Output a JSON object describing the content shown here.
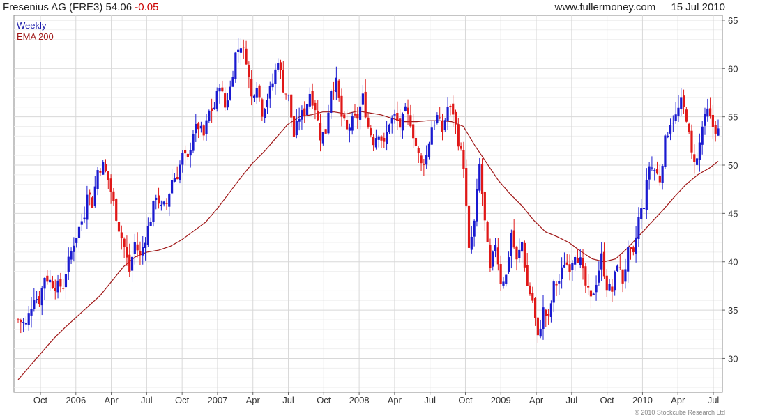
{
  "header": {
    "name_symbol": "Fresenius AG (FRE3)",
    "price": "54.06",
    "change": "-0.05",
    "site": "www.fullermoney.com",
    "date": "15 Jul 2010"
  },
  "legend": {
    "weekly": "Weekly",
    "ema": "EMA 200"
  },
  "copyright": "© 2010 Stockcube Research Ltd",
  "colors": {
    "up": "#1a1ad0",
    "down": "#e01818",
    "ema": "#a01818",
    "grid": "#d8d8d8",
    "minor_grid": "#efefef"
  },
  "chart_data": {
    "type": "candlestick",
    "interval": "weekly",
    "x_tick_labels": [
      "Oct",
      "2006",
      "Apr",
      "Jul",
      "Oct",
      "2007",
      "Apr",
      "Jul",
      "Oct",
      "2008",
      "Apr",
      "Jul",
      "Oct",
      "2009",
      "Apr",
      "Jul",
      "Oct",
      "2010",
      "Apr",
      "Jul"
    ],
    "y_ticks": [
      30,
      35,
      40,
      45,
      50,
      55,
      60,
      65
    ],
    "ylim": [
      26.5,
      65.5
    ],
    "grid": true,
    "legend_position": "top-left",
    "y_axis_side": "right",
    "series": [
      {
        "name": "EMA 200",
        "type": "line",
        "points": [
          [
            0,
            27.8
          ],
          [
            4,
            29.2
          ],
          [
            8,
            30.6
          ],
          [
            12,
            32.0
          ],
          [
            16,
            33.2
          ],
          [
            20,
            34.3
          ],
          [
            24,
            35.4
          ],
          [
            28,
            36.5
          ],
          [
            32,
            38.0
          ],
          [
            36,
            39.5
          ],
          [
            40,
            40.5
          ],
          [
            44,
            41.0
          ],
          [
            48,
            41.2
          ],
          [
            52,
            41.6
          ],
          [
            56,
            42.3
          ],
          [
            60,
            43.2
          ],
          [
            64,
            44.1
          ],
          [
            68,
            45.5
          ],
          [
            72,
            47.1
          ],
          [
            76,
            48.7
          ],
          [
            80,
            50.2
          ],
          [
            84,
            51.4
          ],
          [
            88,
            52.8
          ],
          [
            92,
            54.2
          ],
          [
            96,
            55.0
          ],
          [
            100,
            55.2
          ],
          [
            104,
            55.5
          ],
          [
            108,
            55.5
          ],
          [
            112,
            55.3
          ],
          [
            116,
            55.6
          ],
          [
            120,
            55.4
          ],
          [
            124,
            55.2
          ],
          [
            128,
            54.8
          ],
          [
            132,
            54.5
          ],
          [
            136,
            54.5
          ],
          [
            140,
            54.6
          ],
          [
            144,
            54.6
          ],
          [
            148,
            54.5
          ],
          [
            152,
            54.0
          ],
          [
            156,
            52.0
          ],
          [
            160,
            50.2
          ],
          [
            164,
            48.4
          ],
          [
            168,
            47.0
          ],
          [
            172,
            45.8
          ],
          [
            176,
            44.3
          ],
          [
            180,
            43.1
          ],
          [
            184,
            42.6
          ],
          [
            188,
            42.0
          ],
          [
            192,
            41.1
          ],
          [
            196,
            40.3
          ],
          [
            200,
            40.0
          ],
          [
            204,
            40.3
          ],
          [
            208,
            41.4
          ],
          [
            212,
            42.7
          ],
          [
            216,
            44.0
          ],
          [
            220,
            45.3
          ],
          [
            224,
            46.7
          ],
          [
            228,
            48.0
          ],
          [
            232,
            49.0
          ],
          [
            236,
            49.7
          ],
          [
            239,
            50.4
          ]
        ]
      },
      {
        "name": "Weekly",
        "type": "candlestick",
        "anchors": [
          [
            0,
            34.0
          ],
          [
            3,
            33.5
          ],
          [
            6,
            36.5
          ],
          [
            8,
            36.0
          ],
          [
            10,
            38.5
          ],
          [
            12,
            38.0
          ],
          [
            14,
            37.5
          ],
          [
            17,
            37.5
          ],
          [
            18,
            39.0
          ],
          [
            21,
            42.0
          ],
          [
            23,
            43.5
          ],
          [
            25,
            45.0
          ],
          [
            26,
            47.5
          ],
          [
            28,
            46.0
          ],
          [
            30,
            49.5
          ],
          [
            32,
            50.0
          ],
          [
            34,
            48.5
          ],
          [
            36,
            46.0
          ],
          [
            38,
            43.5
          ],
          [
            40,
            41.5
          ],
          [
            42,
            39.0
          ],
          [
            44,
            42.0
          ],
          [
            46,
            40.5
          ],
          [
            48,
            42.5
          ],
          [
            50,
            44.5
          ],
          [
            52,
            47.0
          ],
          [
            54,
            45.5
          ],
          [
            56,
            46.0
          ],
          [
            58,
            48.5
          ],
          [
            60,
            49.0
          ],
          [
            62,
            51.0
          ],
          [
            64,
            50.5
          ],
          [
            66,
            53.5
          ],
          [
            68,
            54.0
          ],
          [
            70,
            53.0
          ],
          [
            72,
            55.5
          ],
          [
            74,
            56.0
          ],
          [
            76,
            58.5
          ],
          [
            78,
            56.0
          ],
          [
            80,
            58.0
          ],
          [
            82,
            61.5
          ],
          [
            84,
            62.5
          ],
          [
            86,
            61.0
          ],
          [
            88,
            57.0
          ],
          [
            90,
            58.5
          ],
          [
            92,
            55.5
          ],
          [
            94,
            57.0
          ],
          [
            96,
            58.5
          ],
          [
            98,
            61.0
          ],
          [
            100,
            58.0
          ],
          [
            102,
            57.0
          ],
          [
            104,
            53.0
          ],
          [
            106,
            55.0
          ],
          [
            108,
            55.5
          ],
          [
            110,
            57.5
          ],
          [
            112,
            56.0
          ],
          [
            114,
            53.0
          ],
          [
            116,
            53.5
          ],
          [
            118,
            58.0
          ],
          [
            120,
            58.5
          ],
          [
            122,
            55.0
          ],
          [
            124,
            53.5
          ],
          [
            126,
            54.5
          ],
          [
            128,
            55.0
          ],
          [
            130,
            57.0
          ],
          [
            132,
            54.0
          ],
          [
            134,
            52.5
          ],
          [
            136,
            53.5
          ],
          [
            138,
            52.0
          ],
          [
            140,
            54.5
          ],
          [
            142,
            55.0
          ],
          [
            144,
            54.0
          ],
          [
            146,
            55.5
          ],
          [
            148,
            54.5
          ],
          [
            150,
            52.0
          ],
          [
            152,
            50.0
          ],
          [
            154,
            51.0
          ],
          [
            156,
            54.0
          ],
          [
            158,
            55.0
          ],
          [
            160,
            53.5
          ],
          [
            162,
            56.0
          ],
          [
            164,
            55.5
          ],
          [
            166,
            52.5
          ],
          [
            168,
            50.0
          ],
          [
            170,
            41.0
          ],
          [
            172,
            44.0
          ],
          [
            174,
            50.0
          ],
          [
            176,
            44.0
          ],
          [
            178,
            39.0
          ],
          [
            180,
            42.0
          ],
          [
            182,
            38.0
          ],
          [
            184,
            38.5
          ],
          [
            186,
            43.0
          ],
          [
            188,
            40.0
          ],
          [
            190,
            42.0
          ],
          [
            192,
            37.5
          ],
          [
            194,
            36.0
          ],
          [
            196,
            32.0
          ],
          [
            198,
            35.0
          ],
          [
            200,
            34.0
          ],
          [
            202,
            37.5
          ],
          [
            204,
            38.0
          ],
          [
            206,
            40.0
          ],
          [
            208,
            39.5
          ],
          [
            210,
            41.0
          ],
          [
            212,
            40.0
          ],
          [
            214,
            37.5
          ],
          [
            216,
            36.0
          ],
          [
            218,
            38.0
          ],
          [
            220,
            40.5
          ],
          [
            222,
            37.5
          ],
          [
            224,
            37.0
          ],
          [
            226,
            40.0
          ],
          [
            228,
            38.0
          ],
          [
            230,
            41.0
          ],
          [
            232,
            40.5
          ],
          [
            234,
            44.5
          ],
          [
            236,
            46.0
          ],
          [
            238,
            50.0
          ],
          [
            240,
            49.5
          ],
          [
            242,
            48.5
          ],
          [
            244,
            52.5
          ],
          [
            246,
            54.5
          ],
          [
            248,
            55.0
          ],
          [
            250,
            56.5
          ],
          [
            252,
            55.0
          ],
          [
            254,
            51.0
          ],
          [
            256,
            50.5
          ],
          [
            258,
            54.0
          ],
          [
            260,
            55.5
          ],
          [
            262,
            54.0
          ],
          [
            264,
            53.5
          ]
        ]
      }
    ]
  }
}
